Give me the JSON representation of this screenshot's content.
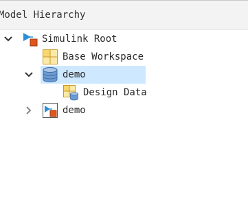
{
  "panel": {
    "title": "Model Hierarchy"
  },
  "tree": {
    "nodes": [
      {
        "label": "Simulink Root",
        "expanded": true,
        "icon": "simulink-root-icon"
      },
      {
        "label": "Base Workspace",
        "icon": "workspace-grid-icon"
      },
      {
        "label": "demo",
        "expanded": true,
        "selected": true,
        "icon": "database-icon"
      },
      {
        "label": "Design Data",
        "icon": "design-data-icon"
      },
      {
        "label": "demo",
        "expanded": false,
        "icon": "simulink-model-icon"
      }
    ]
  },
  "colors": {
    "selection": "#cde8ff",
    "header_bg": "#f3f3f3",
    "simulink_blue": "#2a8fd6",
    "simulink_orange": "#e0561b",
    "grid_yellow": "#f7d66b"
  }
}
